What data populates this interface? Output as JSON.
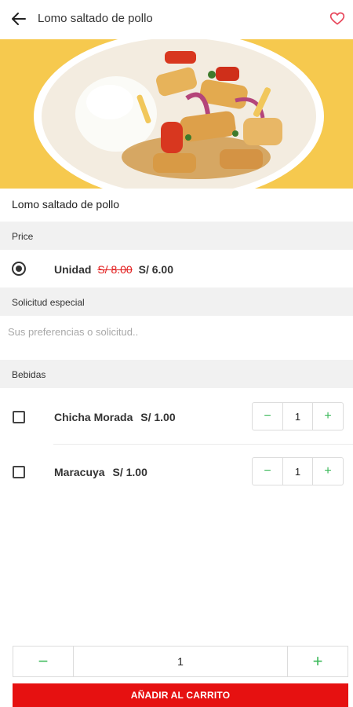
{
  "header": {
    "title": "Lomo saltado de pollo",
    "back_icon": "arrow-left-icon",
    "fav_icon": "heart-outline-icon"
  },
  "hero": {
    "description_icon": "dish-photo"
  },
  "dish": {
    "name": "Lomo saltado de pollo"
  },
  "price_section": {
    "title": "Price",
    "option": {
      "label": "Unidad",
      "old_price": "S/ 8.00",
      "new_price": "S/ 6.00",
      "selected": true
    }
  },
  "special_request": {
    "title": "Solicitud especial",
    "placeholder": "Sus preferencias o solicitud.."
  },
  "drinks_section": {
    "title": "Bebidas",
    "items": [
      {
        "name": "Chicha Morada",
        "price": "S/ 1.00",
        "qty": "1",
        "minus": "−",
        "plus": "+"
      },
      {
        "name": "Maracuya",
        "price": "S/ 1.00",
        "qty": "1",
        "minus": "−",
        "plus": "+"
      }
    ]
  },
  "cart": {
    "qty": "1",
    "minus": "−",
    "plus": "+",
    "add_label": "AÑADIR AL CARRITO"
  },
  "colors": {
    "accent_red": "#e61111",
    "price_strike": "#e21b1b",
    "stepper_green": "#3cb95a",
    "hero_bg": "#f6c94e"
  }
}
